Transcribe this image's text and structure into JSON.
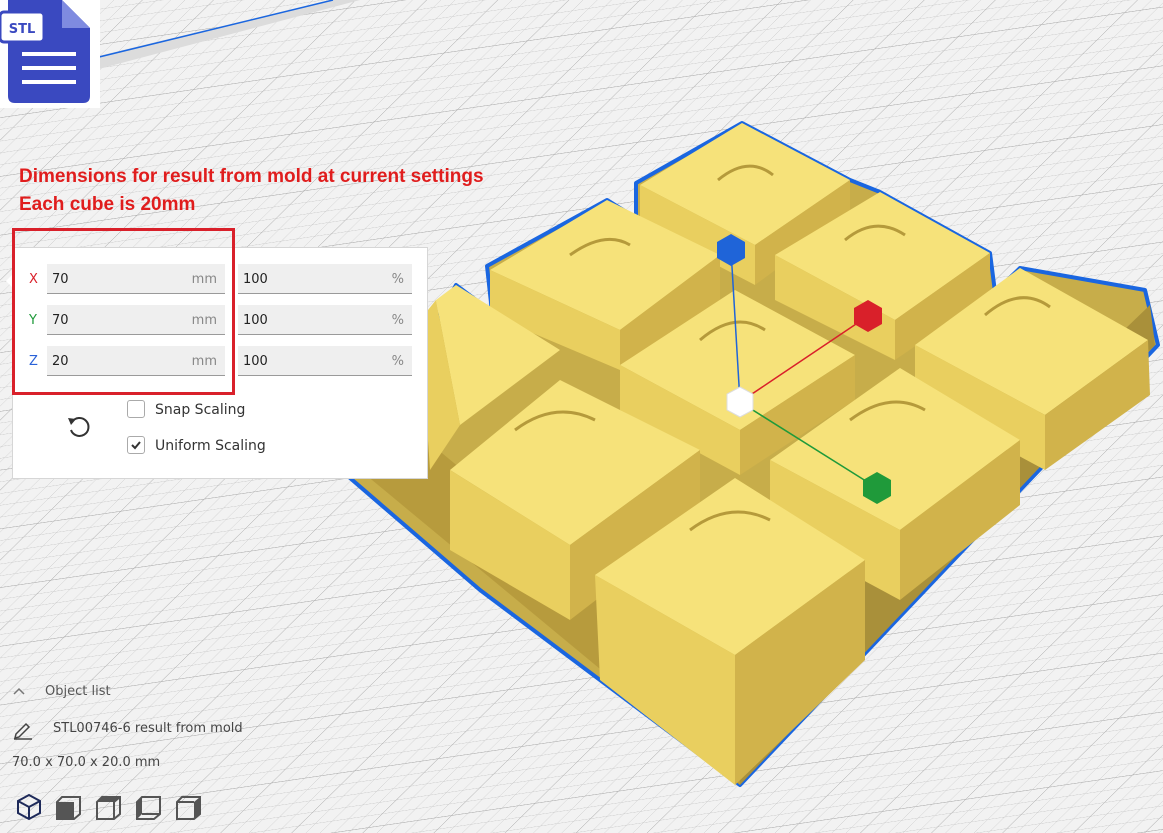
{
  "annotation": {
    "line1": "Dimensions for result from mold at current settings",
    "line2": "Each cube is 20mm",
    "color": "#e01d1d"
  },
  "logo": {
    "text": "STL",
    "color": "#3a49c0"
  },
  "scale_panel": {
    "rows": [
      {
        "axis": "X",
        "axis_color": "#d9202a",
        "value": "70",
        "unit": "mm",
        "percent": "100",
        "percent_unit": "%"
      },
      {
        "axis": "Y",
        "axis_color": "#1f9a3a",
        "value": "70",
        "unit": "mm",
        "percent": "100",
        "percent_unit": "%"
      },
      {
        "axis": "Z",
        "axis_color": "#2a62d8",
        "value": "20",
        "unit": "mm",
        "percent": "100",
        "percent_unit": "%"
      }
    ],
    "snap_scaling": {
      "label": "Snap Scaling",
      "checked": false
    },
    "uniform_scaling": {
      "label": "Uniform Scaling",
      "checked": true
    },
    "reset_icon": "undo-icon"
  },
  "object_list": {
    "label": "Object list",
    "object_name": "STL00746-6 result from mold",
    "dimensions": "70.0 x 70.0 x 20.0 mm"
  },
  "view_buttons": [
    "3d-view-icon",
    "front-view-icon",
    "top-view-icon",
    "left-view-icon",
    "right-view-icon"
  ],
  "colors": {
    "model": "#f5e072",
    "outline": "#1a66e0",
    "handle_x": "#d9202a",
    "handle_y": "#1f9a3a",
    "handle_z": "#1f64d8"
  }
}
